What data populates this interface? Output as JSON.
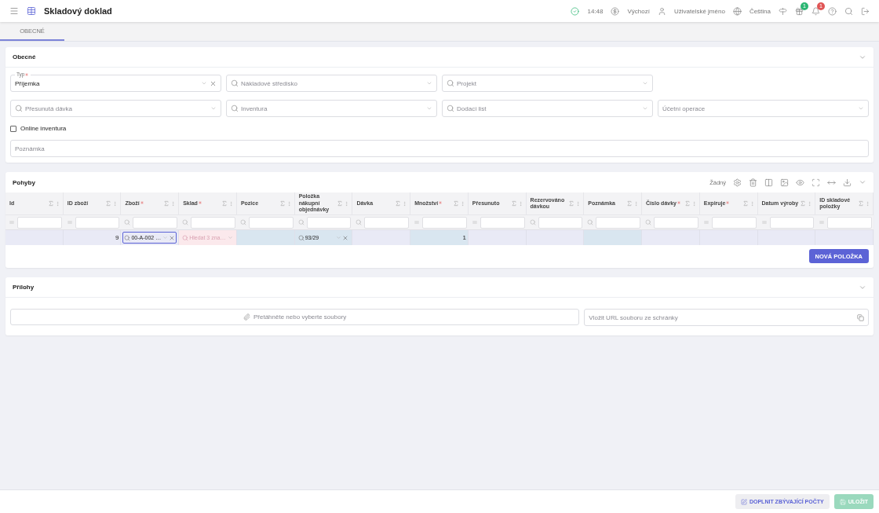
{
  "topbar": {
    "title": "Skladový doklad",
    "status_time": "14:48",
    "currency": "Výchozí",
    "user": "Uživatelské jméno",
    "language": "Čeština",
    "gift_badge": "1",
    "bell_badge": "1"
  },
  "tabs": [
    {
      "label": "OBECNÉ",
      "selected": true
    }
  ],
  "general": {
    "title": "Obecné",
    "fields": [
      {
        "kind": "select",
        "label": "Typ",
        "required": true,
        "value": "Příjemka"
      },
      {
        "kind": "search",
        "placeholder": "Nákladové středisko"
      },
      {
        "kind": "search",
        "placeholder": "Projekt"
      },
      {
        "kind": "empty"
      },
      {
        "kind": "search",
        "placeholder": "Přesunutá dávka"
      },
      {
        "kind": "search",
        "placeholder": "Inventura"
      },
      {
        "kind": "search",
        "placeholder": "Dodací list"
      },
      {
        "kind": "dropdown",
        "placeholder": "Účetní operace"
      }
    ],
    "checkbox": {
      "label": "Online inventura",
      "checked": false
    },
    "note": {
      "placeholder": "Poznámka"
    }
  },
  "movements": {
    "title": "Pohyby",
    "grouping": "Žádný",
    "columns": [
      {
        "label": "Id",
        "required": false,
        "kind": "equals"
      },
      {
        "label": "ID zboží",
        "required": false,
        "kind": "equals"
      },
      {
        "label": "Zboží",
        "required": true,
        "kind": "search"
      },
      {
        "label": "Sklad",
        "required": true,
        "kind": "search"
      },
      {
        "label": "Pozice",
        "required": false,
        "kind": "search"
      },
      {
        "label": "Položka nákupní objednávky",
        "required": false,
        "kind": "search"
      },
      {
        "label": "Dávka",
        "required": false,
        "kind": "search"
      },
      {
        "label": "Množství",
        "required": true,
        "kind": "equals"
      },
      {
        "label": "Přesunuto",
        "required": false,
        "kind": "equals"
      },
      {
        "label": "Rezervováno dávkou",
        "required": false,
        "kind": "search"
      },
      {
        "label": "Poznámka",
        "required": false,
        "kind": "search"
      },
      {
        "label": "Číslo dávky",
        "required": true,
        "kind": "search"
      },
      {
        "label": "Expiruje",
        "required": true,
        "kind": "equals"
      },
      {
        "label": "Datum výroby",
        "required": false,
        "kind": "equals"
      },
      {
        "label": "ID skladové položky",
        "required": false,
        "kind": "equals"
      }
    ],
    "row": [
      {
        "kind": "plain"
      },
      {
        "kind": "plain",
        "text": "9"
      },
      {
        "kind": "active-field",
        "text": "00-A-002 …"
      },
      {
        "kind": "error-field",
        "placeholder": "Hledat 3 zna…"
      },
      {
        "kind": "editable"
      },
      {
        "kind": "field",
        "text": "93/29"
      },
      {
        "kind": "plain"
      },
      {
        "kind": "editable",
        "text": "1"
      },
      {
        "kind": "plain"
      },
      {
        "kind": "plain"
      },
      {
        "kind": "editable"
      },
      {
        "kind": "plain"
      },
      {
        "kind": "plain"
      },
      {
        "kind": "plain"
      },
      {
        "kind": "plain"
      }
    ],
    "add_button": "NOVÁ POLOŽKA"
  },
  "attachments": {
    "title": "Přílohy",
    "drop": "Přetáhněte nebo vyberte soubory",
    "url_placeholder": "Vložit URL souboru ze schránky"
  },
  "footer": [
    {
      "label": "DOPLNIT ZBÝVAJÍCÍ POČTY",
      "kind": "secondary",
      "disabled": false
    },
    {
      "label": "ULOŽIT",
      "kind": "primary",
      "disabled": true
    }
  ]
}
